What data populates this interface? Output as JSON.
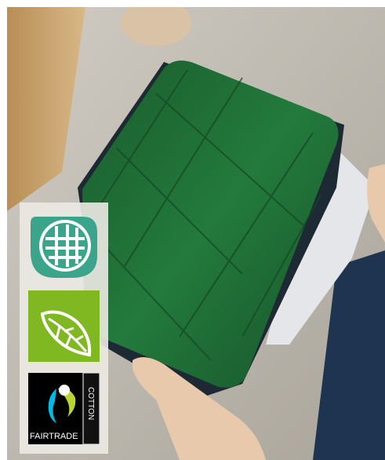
{
  "badges": {
    "organic_textile": {
      "icon": "woven-fabric-icon",
      "color": "#3aa58b"
    },
    "eco_leaf": {
      "icon": "leaf-icon",
      "color": "#7fb821"
    },
    "fairtrade": {
      "text": "FAIRTRADE",
      "side_text": "COTTON",
      "icon": "fairtrade-mark-icon",
      "colors": [
        "#000000",
        "#00b9e4",
        "#b7d433"
      ]
    }
  },
  "colors": {
    "sleeve": "#1f6a35",
    "sleeve_dark": "#154d26",
    "zipper": "#1d2a33",
    "table": "#bdb8ae",
    "wood": "#c9a571",
    "jeans": "#1e3450"
  }
}
